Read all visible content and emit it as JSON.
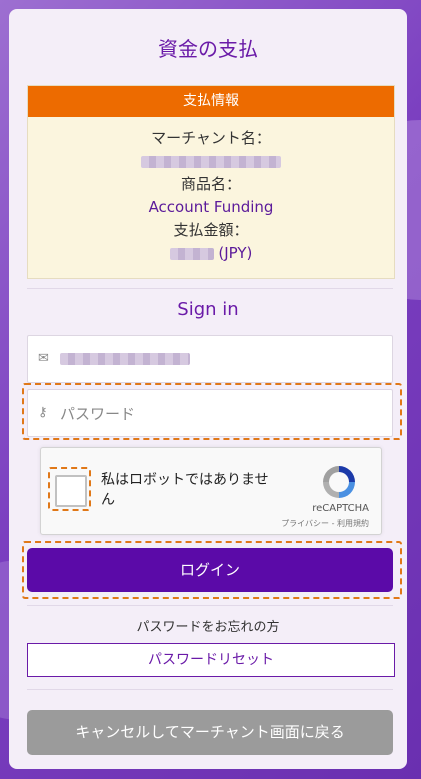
{
  "page": {
    "title": "資金の支払"
  },
  "payment_info": {
    "header": "支払情報",
    "merchant_label": "マーチャント名：",
    "product_label": "商品名：",
    "product_value": "Account Funding",
    "amount_label": "支払金額：",
    "amount_currency": "(JPY)"
  },
  "signin": {
    "heading": "Sign in",
    "password_placeholder": "パスワード",
    "login_button": "ログイン",
    "forgot_text": "パスワードをお忘れの方",
    "reset_button": "パスワードリセット",
    "cancel_button": "キャンセルしてマーチャント画面に戻る"
  },
  "captcha": {
    "label": "私はロボットではありません",
    "brand": "reCAPTCHA",
    "links": "プライバシー - 利用規約"
  },
  "colors": {
    "accent": "#5b0aa8",
    "header_orange": "#ed6b00",
    "highlight": "#e07818"
  }
}
